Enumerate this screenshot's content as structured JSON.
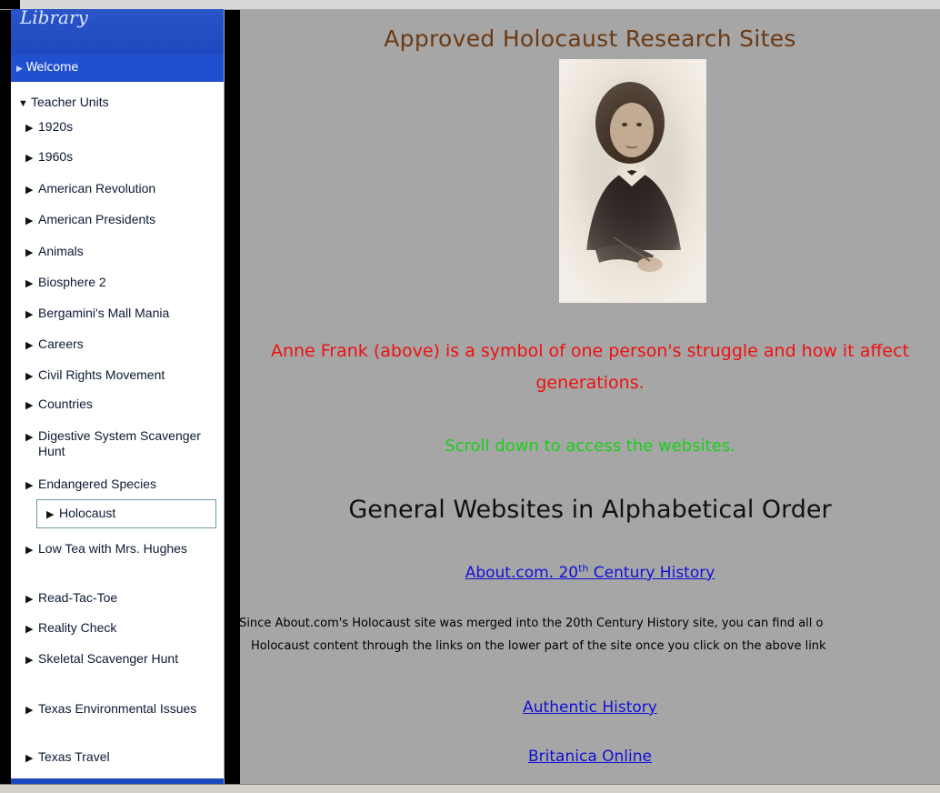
{
  "sidebar": {
    "header": "Library",
    "welcome": "Welcome",
    "section": "Teacher Units",
    "items": [
      {
        "label": "1920s"
      },
      {
        "label": "1960s"
      },
      {
        "label": "American Revolution"
      },
      {
        "label": "American Presidents"
      },
      {
        "label": "Animals"
      },
      {
        "label": "Biosphere 2"
      },
      {
        "label": "Bergamini's Mall Mania"
      },
      {
        "label": "Careers"
      },
      {
        "label": "Civil Rights Movement"
      },
      {
        "label": "Countries"
      },
      {
        "label": "Digestive System Scavenger Hunt"
      },
      {
        "label": "Endangered Species"
      },
      {
        "label": "Holocaust"
      },
      {
        "label": "Low Tea with Mrs. Hughes"
      },
      {
        "label": "Read-Tac-Toe"
      },
      {
        "label": "Reality Check"
      },
      {
        "label": "Skeletal Scavenger Hunt"
      },
      {
        "label": "Texas Environmental Issues"
      },
      {
        "label": "Texas Travel"
      }
    ],
    "selected": "Holocaust"
  },
  "main": {
    "title": "Approved Holocaust Research Sites",
    "caption_line1": "Anne Frank (above) is a symbol of one person's struggle and how it affect",
    "caption_line2": "generations.",
    "scroll_note": "Scroll down to access the websites.",
    "heading": "General Websites in Alphabetical Order",
    "links": {
      "about_prefix": "About.com. 20",
      "about_sup": "th",
      "about_suffix": " Century History",
      "authentic": "Authentic History",
      "britanica": "Britanica Online"
    },
    "note_line1": "(Since About.com's Holocaust site was merged into the 20th Century History site, you can find all o",
    "note_line2": "Holocaust content through the links on the lower part of the site once you click on the above link"
  },
  "colors": {
    "title": "#6b3a14",
    "caption": "#f01010",
    "scroll_note": "#18d018",
    "link": "#1010d8",
    "content_bg": "#a6a6a6",
    "sidebar_header": "#1d49c0"
  },
  "icons": {
    "expanded": "triangle-down-icon",
    "collapsed": "triangle-right-icon"
  }
}
